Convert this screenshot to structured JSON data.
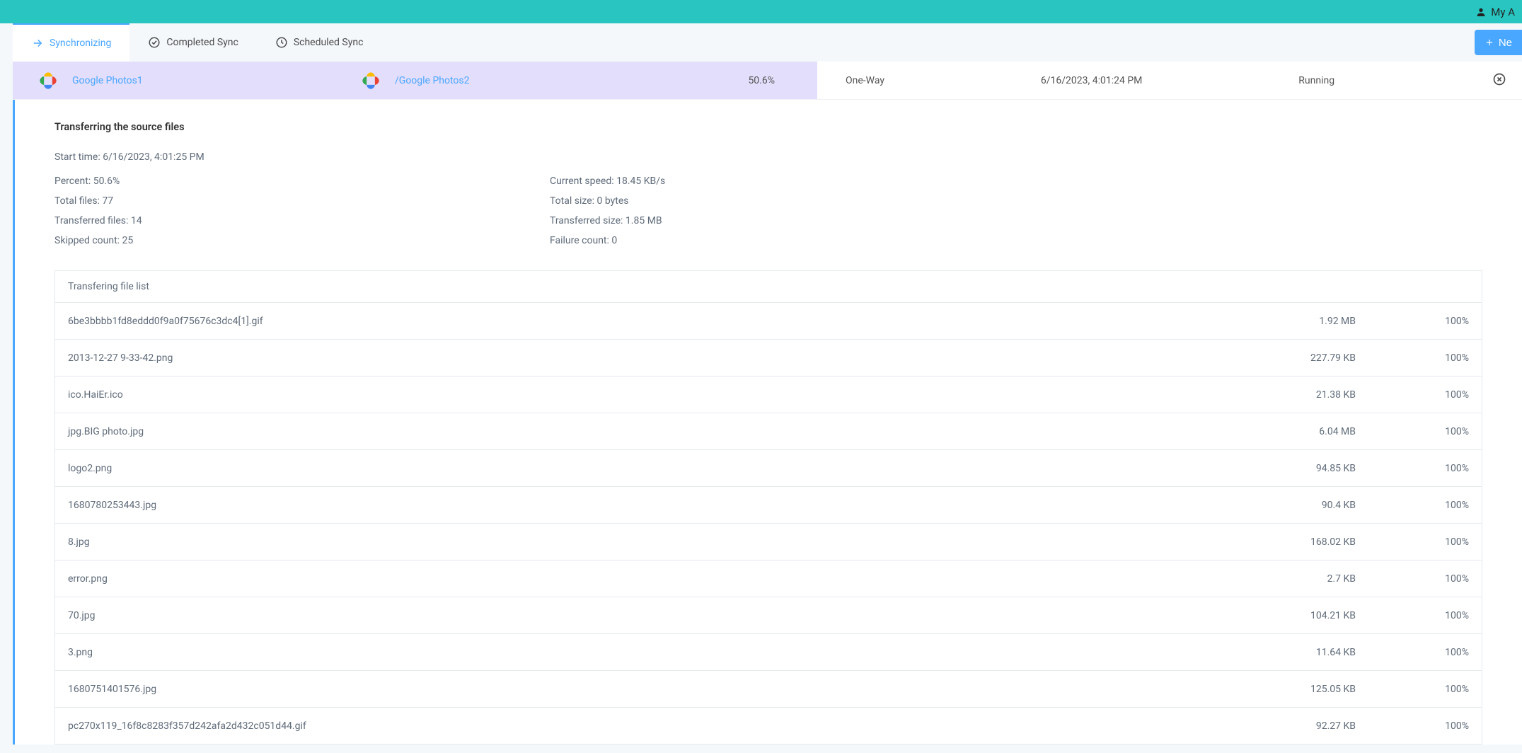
{
  "header": {
    "account_label": "My A"
  },
  "tabs": {
    "synchronizing": "Synchronizing",
    "completed": "Completed Sync",
    "scheduled": "Scheduled Sync"
  },
  "new_button": "Ne",
  "task": {
    "source_label": "Google Photos1",
    "dest_label": "/Google Photos2",
    "percent": "50.6%",
    "mode": "One-Way",
    "datetime": "6/16/2023, 4:01:24 PM",
    "status": "Running"
  },
  "details": {
    "section_title": "Transferring the source files",
    "start_time_label": "Start time: ",
    "start_time_value": "6/16/2023, 4:01:25 PM",
    "percent_label": "Percent: ",
    "percent_value": "50.6%",
    "current_speed_label": "Current speed: ",
    "current_speed_value": "18.45 KB/s",
    "total_files_label": "Total files: ",
    "total_files_value": "77",
    "total_size_label": "Total size: ",
    "total_size_value": "0 bytes",
    "transferred_files_label": "Transferred files: ",
    "transferred_files_value": "14",
    "transferred_size_label": "Transferred size: ",
    "transferred_size_value": "1.85 MB",
    "skipped_label": "Skipped count: ",
    "skipped_value": "25",
    "failure_label": "Failure count: ",
    "failure_value": "0"
  },
  "file_table": {
    "header": "Transfering file list",
    "rows": [
      {
        "name": "6be3bbbb1fd8eddd0f9a0f75676c3dc4[1].gif",
        "size": "1.92 MB",
        "progress": "100%"
      },
      {
        "name": "2013-12-27 9-33-42.png",
        "size": "227.79 KB",
        "progress": "100%"
      },
      {
        "name": "ico.HaiEr.ico",
        "size": "21.38 KB",
        "progress": "100%"
      },
      {
        "name": "jpg.BIG photo.jpg",
        "size": "6.04 MB",
        "progress": "100%"
      },
      {
        "name": "logo2.png",
        "size": "94.85 KB",
        "progress": "100%"
      },
      {
        "name": "1680780253443.jpg",
        "size": "90.4 KB",
        "progress": "100%"
      },
      {
        "name": "8.jpg",
        "size": "168.02 KB",
        "progress": "100%"
      },
      {
        "name": "error.png",
        "size": "2.7 KB",
        "progress": "100%"
      },
      {
        "name": "70.jpg",
        "size": "104.21 KB",
        "progress": "100%"
      },
      {
        "name": "3.png",
        "size": "11.64 KB",
        "progress": "100%"
      },
      {
        "name": "1680751401576.jpg",
        "size": "125.05 KB",
        "progress": "100%"
      },
      {
        "name": "pc270x119_16f8c8283f357d242afa2d432c051d44.gif",
        "size": "92.27 KB",
        "progress": "100%"
      }
    ]
  }
}
